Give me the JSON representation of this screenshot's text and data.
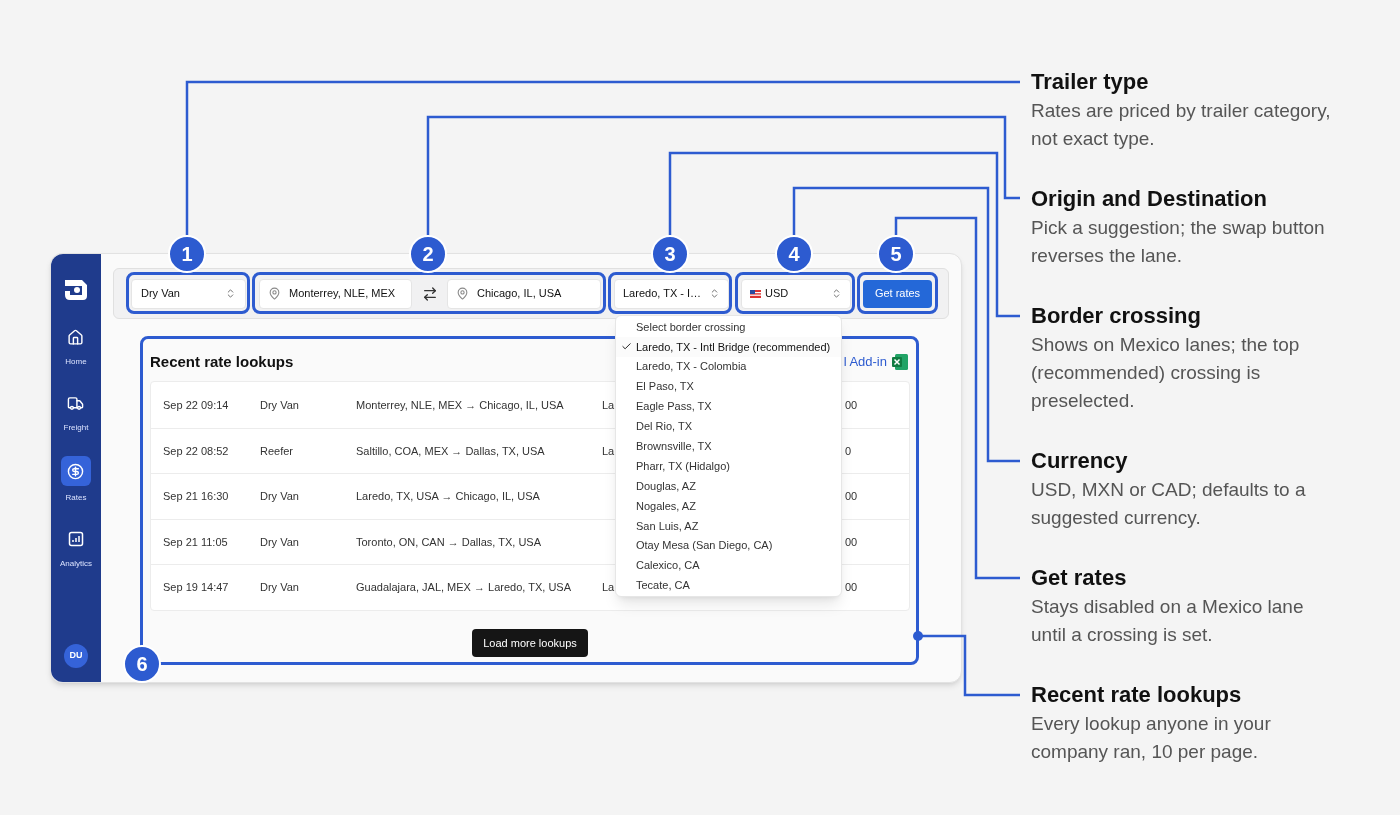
{
  "sidebar": {
    "items": [
      {
        "label": "Home",
        "selected": false
      },
      {
        "label": "Freight",
        "selected": false
      },
      {
        "label": "Rates",
        "selected": true
      },
      {
        "label": "Analytics",
        "selected": false
      }
    ],
    "avatar": "DU"
  },
  "toolbar": {
    "trailer_type": "Dry Van",
    "origin": "Monterrey, NLE, MEX",
    "destination": "Chicago, IL, USA",
    "border_crossing": "Laredo, TX - I…",
    "currency": "USD",
    "get_rates": "Get rates"
  },
  "border_dropdown": {
    "options": [
      {
        "label": "Select border crossing",
        "selected": false
      },
      {
        "label": "Laredo, TX - Intl Bridge (recommended)",
        "selected": true
      },
      {
        "label": "Laredo, TX - Colombia",
        "selected": false
      },
      {
        "label": "El Paso, TX",
        "selected": false
      },
      {
        "label": "Eagle Pass, TX",
        "selected": false
      },
      {
        "label": "Del Rio, TX",
        "selected": false
      },
      {
        "label": "Brownsville, TX",
        "selected": false
      },
      {
        "label": "Pharr, TX (Hidalgo)",
        "selected": false
      },
      {
        "label": "Douglas, AZ",
        "selected": false
      },
      {
        "label": "Nogales, AZ",
        "selected": false
      },
      {
        "label": "San Luis, AZ",
        "selected": false
      },
      {
        "label": "Otay Mesa (San Diego, CA)",
        "selected": false
      },
      {
        "label": "Calexico, CA",
        "selected": false
      },
      {
        "label": "Tecate, CA",
        "selected": false
      }
    ]
  },
  "recent": {
    "title": "Recent rate lookups",
    "add_in": "l Add-in",
    "rows": [
      {
        "time": "Sep 22 09:14",
        "trailer": "Dry Van",
        "lane": "Monterrey, NLE, MEX → Chicago, IL, USA",
        "column_4": "La",
        "column_5": "00"
      },
      {
        "time": "Sep 22 08:52",
        "trailer": "Reefer",
        "lane": "Saltillo, COA, MEX → Dallas, TX, USA",
        "column_4": "La",
        "column_5": "0"
      },
      {
        "time": "Sep 21 16:30",
        "trailer": "Dry Van",
        "lane": "Laredo, TX, USA → Chicago, IL, USA",
        "column_5": "00"
      },
      {
        "time": "Sep 21 11:05",
        "trailer": "Dry Van",
        "lane": "Toronto, ON, CAN → Dallas, TX, USA",
        "column_5": "00"
      },
      {
        "time": "Sep 19 14:47",
        "trailer": "Dry Van",
        "lane": "Guadalajara, JAL, MEX → Laredo, TX, USA",
        "column_4": "La",
        "column_5": "00"
      }
    ],
    "load_more": "Load more lookups"
  },
  "callouts": [
    {
      "number": "1",
      "title": "Trailer type",
      "description": "Rates are priced by trailer category, not exact type."
    },
    {
      "number": "2",
      "title": "Origin and Destination",
      "description": "Pick a suggestion; the swap button reverses the lane."
    },
    {
      "number": "3",
      "title": "Border crossing",
      "description": "Shows on Mexico lanes; the top (recommended) crossing is preselected."
    },
    {
      "number": "4",
      "title": "Currency",
      "description": "USD, MXN or CAD; defaults to a suggested currency."
    },
    {
      "number": "5",
      "title": "Get rates",
      "description": "Stays disabled on a Mexico lane until a crossing is set."
    },
    {
      "number": "6",
      "title": "Recent rate lookups",
      "description": "Every lookup anyone in your company ran, 10 per page."
    }
  ]
}
